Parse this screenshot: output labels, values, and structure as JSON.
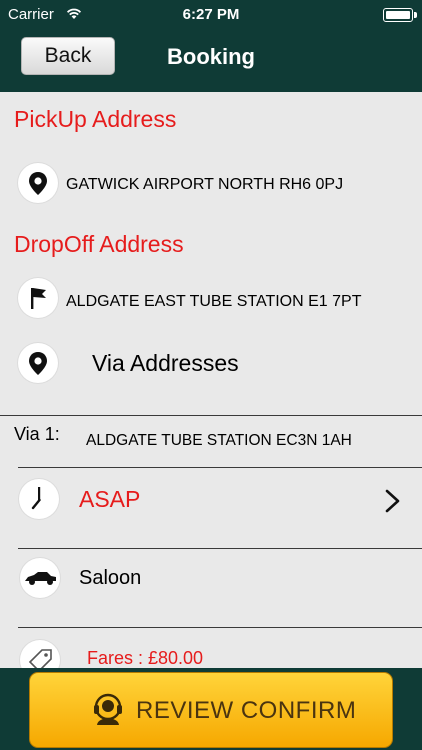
{
  "status_bar": {
    "carrier": "Carrier",
    "time": "6:27 PM"
  },
  "nav": {
    "back_label": "Back",
    "title": "Booking"
  },
  "pickup": {
    "title": "PickUp Address",
    "address": "GATWICK AIRPORT NORTH RH6 0PJ"
  },
  "dropoff": {
    "title": "DropOff Address",
    "address": "ALDGATE EAST TUBE STATION E1 7PT"
  },
  "via": {
    "label": "Via Addresses",
    "items": [
      {
        "label": "Via 1:",
        "address": "ALDGATE TUBE STATION EC3N 1AH"
      }
    ]
  },
  "time": {
    "value": "ASAP"
  },
  "vehicle": {
    "value": "Saloon"
  },
  "fares": {
    "text": "Fares : £80.00"
  },
  "confirm": {
    "label": "REVIEW CONFIRM"
  },
  "colors": {
    "nav_bg": "#0f3b36",
    "accent_red": "#e61c1c",
    "button_yellow": "#f6b500"
  }
}
